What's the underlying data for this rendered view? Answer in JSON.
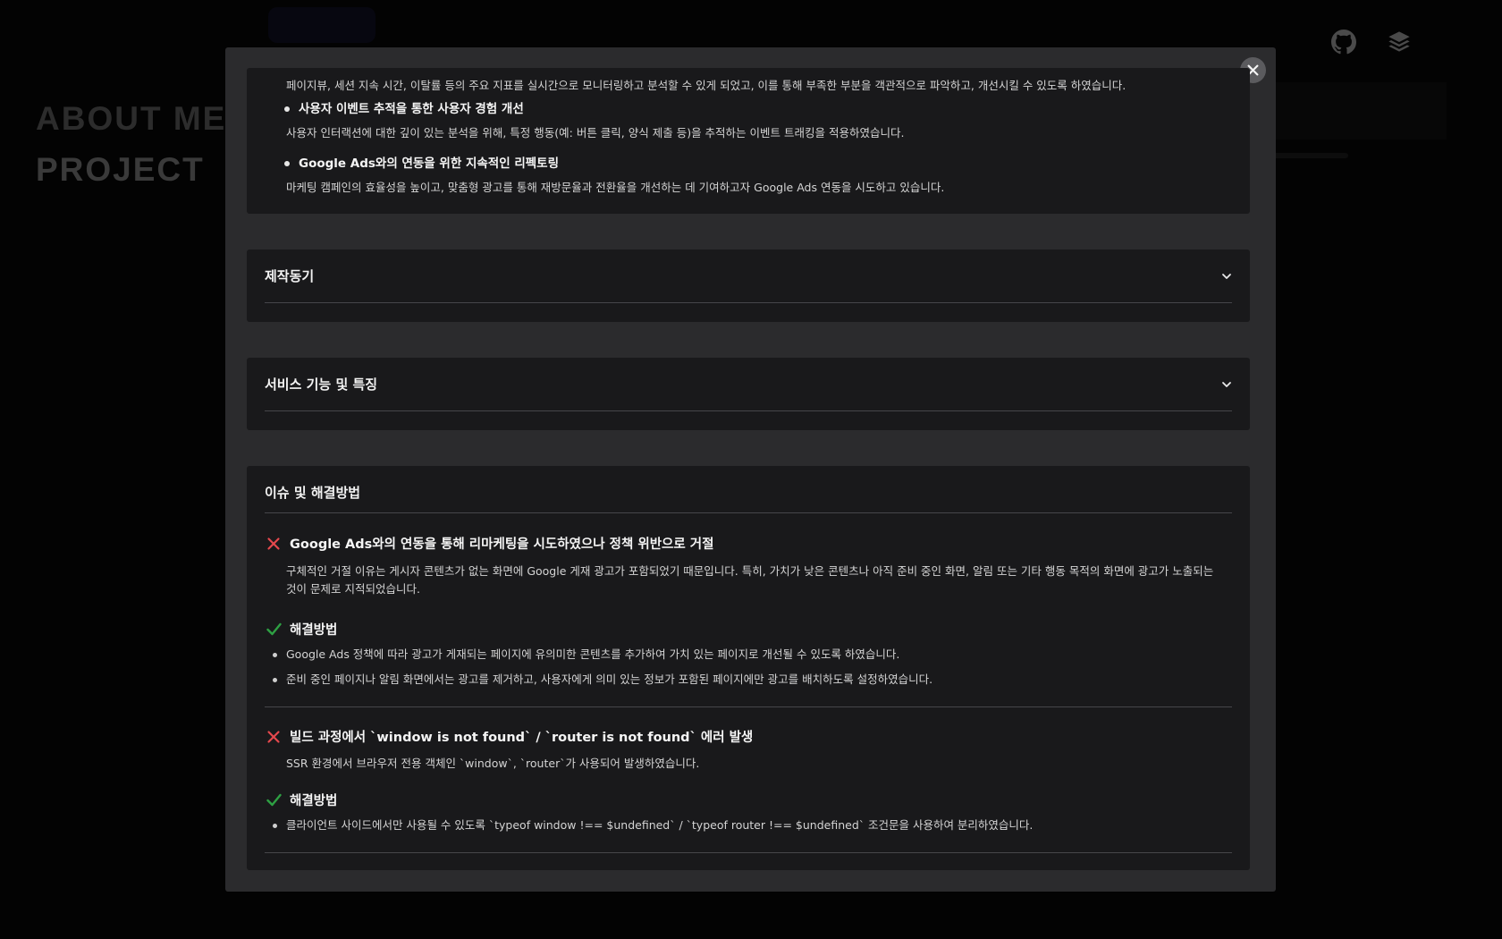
{
  "background": {
    "nav": [
      "ABOUT ME",
      "PROJECT"
    ],
    "icons": [
      "github-icon",
      "stack-icon"
    ]
  },
  "modal": {
    "close_icon": "close-icon",
    "intro": {
      "lead_desc": "페이지뷰, 세션 지속 시간, 이탈률 등의 주요 지표를 실시간으로 모니터링하고 분석할 수 있게 되었고, 이를 통해 부족한 부분을 객관적으로 파악하고, 개선시킬 수 있도록 하였습니다.",
      "items": [
        {
          "title": "사용자 이벤트 추적을 통한 사용자 경험 개선",
          "desc": "사용자 인터랙션에 대한 깊이 있는 분석을 위해, 특정 행동(예: 버튼 클릭, 양식 제출 등)을 추적하는 이벤트 트래킹을 적용하였습니다."
        },
        {
          "title": "Google Ads와의 연동을 위한 지속적인 리펙토링",
          "desc": "마케팅 캠페인의 효율성을 높이고, 맞춤형 광고를 통해 재방문율과 전환율을 개선하는 데 기여하고자 Google Ads 연동을 시도하고 있습니다."
        }
      ]
    },
    "accordions": [
      {
        "title": "제작동기",
        "icon": "chevron-down-icon"
      },
      {
        "title": "서비스 기능 및 특징",
        "icon": "chevron-down-icon"
      }
    ],
    "issues": {
      "title": "이슈 및 해결방법",
      "solution_label": "해결방법",
      "list": [
        {
          "problem": "Google Ads와의 연동을 통해 리마케팅을 시도하였으나 정책 위반으로 거절",
          "problem_desc": "구체적인 거절 이유는 게시자 콘텐츠가 없는 화면에 Google 게재 광고가 포함되었기 때문입니다. 특히, 가치가 낮은 콘텐츠나 아직 준비 중인 화면, 알림 또는 기타 행동 목적의 화면에 광고가 노출되는 것이 문제로 지적되었습니다.",
          "solutions": [
            "Google Ads 정책에 따라 광고가 게재되는 페이지에 유의미한 콘텐츠를 추가하여 가치 있는 페이지로 개선될 수 있도록 하였습니다.",
            "준비 중인 페이지나 알림 화면에서는 광고를 제거하고, 사용자에게 의미 있는 정보가 포함된 페이지에만 광고를 배치하도록 설정하였습니다."
          ]
        },
        {
          "problem": "빌드 과정에서 `window is not found` / `router is not found` 에러 발생",
          "problem_desc": "SSR 환경에서 브라우저 전용 객체인 `window`, `router`가 사용되어 발생하였습니다.",
          "solutions": [
            "클라이언트 사이드에서만 사용될 수 있도록 `typeof window !== $undefined` / `typeof router !== $undefined` 조건문을 사용하여 분리하였습니다."
          ]
        }
      ]
    }
  },
  "colors": {
    "error_icon": "#e5484d",
    "success_icon": "#2ea043",
    "panel": "#19191b",
    "modal": "#2b2b2d"
  }
}
